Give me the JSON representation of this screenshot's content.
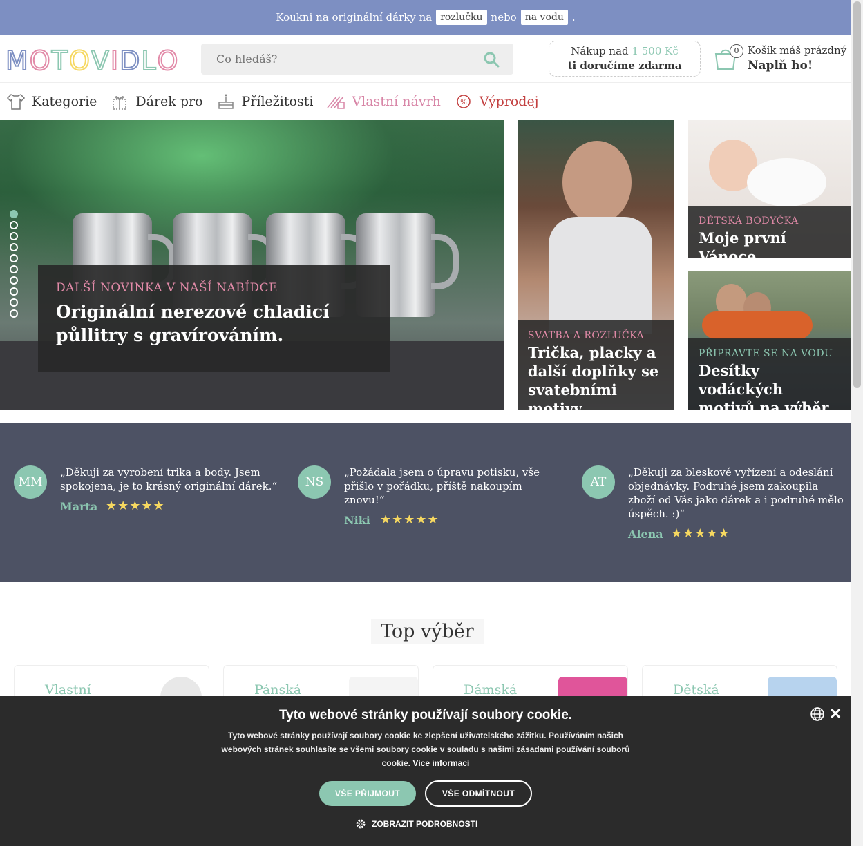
{
  "colors": {
    "promo_bg": "#7d8fc2",
    "accent": "#8cc7b1",
    "pink": "#e28aa8",
    "sale": "#c34040",
    "reviews_bg": "#4d5264",
    "cookie_bg": "#2b2b2b"
  },
  "promo": {
    "text_before": "Koukni na originální dárky na",
    "chip1": "rozlučku",
    "text_middle": "nebo",
    "chip2": "na vodu",
    "text_after": "."
  },
  "logo": {
    "letters": [
      "M",
      "O",
      "T",
      "O",
      "V",
      "I",
      "D",
      "L",
      "O"
    ],
    "colors": [
      "#7d8fc2",
      "#e28aa8",
      "#8cc7b1",
      "#f6d860",
      "#8cc7b1",
      "#e28aa8",
      "#7d8fc2",
      "#8cc7b1",
      "#e28aa8"
    ]
  },
  "search": {
    "placeholder": "Co hledáš?",
    "icon": "search-icon"
  },
  "shipping": {
    "line1": "Nákup nad",
    "price": "1 500 Kč",
    "line2": "ti doručíme zdarma"
  },
  "cart": {
    "count": "0",
    "line1": "Košík máš prázdný",
    "line2": "Naplň ho!",
    "icon": "cart-icon"
  },
  "nav": [
    {
      "label": "Kategorie",
      "icon": "tshirt-icon"
    },
    {
      "label": "Dárek pro",
      "icon": "gift-icon"
    },
    {
      "label": "Příležitosti",
      "icon": "cake-icon"
    },
    {
      "label": "Vlastní návrh",
      "icon": "design-icon"
    },
    {
      "label": "Výprodej",
      "icon": "percent-icon"
    }
  ],
  "hero": {
    "kicker": "DALŠÍ NOVINKA V NAŠÍ NABÍDCE",
    "title": "Originální nerezové chladicí půllitry s gravírováním.",
    "slides": 10,
    "active_slide": 1
  },
  "banners": {
    "wedding": {
      "kicker": "SVATBA A ROZLUČKA",
      "title": "Trička, placky a další doplňky se svatebními motivy"
    },
    "baby": {
      "kicker": "DĚTSKÁ BODYČKA",
      "title": "Moje první Vánoce"
    },
    "water": {
      "kicker": "PŘIPRAVTE SE NA VODU",
      "title": "Desítky vodáckých motivů na výběr"
    }
  },
  "reviews": [
    {
      "initials": "MM",
      "text": "„Děkuji za vyrobení trika a body. Jsem spokojena, je to krásný originální dárek.“",
      "author": "Marta",
      "stars": 5
    },
    {
      "initials": "NS",
      "text": "„Požádala jsem o úpravu potisku, vše přišlo v pořádku, příště nakoupím znovu!“",
      "author": "Niki",
      "stars": 5
    },
    {
      "initials": "AT",
      "text": "„Děkuji za bleskové vyřízení a odeslání objednávky. Podruhé jsem zakoupila zboží od Vás jako dárek a i podruhé mělo úspěch. :)“",
      "author": "Alena",
      "stars": 5
    }
  ],
  "top": {
    "title": "Top výběr",
    "cards": [
      {
        "label": "Vlastní",
        "shirt_color": "#e8e8e8"
      },
      {
        "label": "Pánská",
        "shirt_color": "#f4f4f4"
      },
      {
        "label": "Dámská",
        "shirt_color": "#e0559a"
      },
      {
        "label": "Dětská",
        "shirt_color": "#b7d3ee"
      }
    ]
  },
  "cookie": {
    "title": "Tyto webové stránky používají soubory cookie.",
    "text": "Tyto webové stránky používají soubory cookie ke zlepšení uživatelského zážitku. Používáním našich webových stránek souhlasíte se všemi soubory cookie v souladu s našimi zásadami používání souborů cookie.",
    "more": "Více informací",
    "accept": "VŠE PŘIJMOUT",
    "decline": "VŠE ODMÍTNOUT",
    "details": "ZOBRAZIT PODROBNOSTI"
  }
}
